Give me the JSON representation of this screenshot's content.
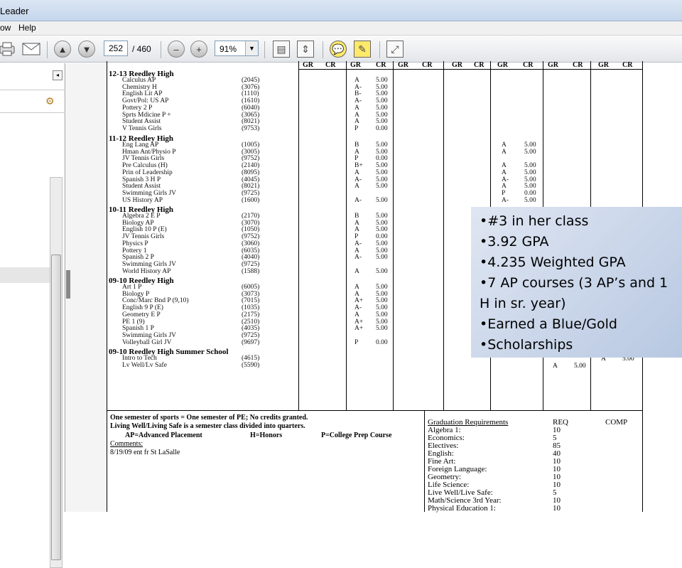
{
  "app": {
    "title": "Leader"
  },
  "menu": [
    "ow",
    "Help"
  ],
  "toolbar": {
    "page_current": "252",
    "page_total": "/ 460",
    "zoom": "91%"
  },
  "columns": [
    "GR",
    "CR",
    "GR",
    "CR",
    "GR",
    "CR",
    "GR",
    "CR",
    "GR",
    "CR",
    "GR",
    "CR"
  ],
  "sections": [
    {
      "title": "12-13  Reedley High",
      "courses": [
        {
          "name": "Calculus AP",
          "code": "(2045)",
          "grade": "A",
          "credit": "5.00"
        },
        {
          "name": "Chemistry H",
          "code": "(3076)",
          "grade": "A-",
          "credit": "5.00"
        },
        {
          "name": "English Lit AP",
          "code": "(1110)",
          "grade": "B-",
          "credit": "5.00"
        },
        {
          "name": "Govt/Pol: US AP",
          "code": "(1610)",
          "grade": "A-",
          "credit": "5.00"
        },
        {
          "name": "Pottery 2 P",
          "code": "(6040)",
          "grade": "A",
          "credit": "5.00"
        },
        {
          "name": "Sprts Mdicine P +",
          "code": "(3065)",
          "grade": "A",
          "credit": "5.00"
        },
        {
          "name": "Student Assist",
          "code": "(8021)",
          "grade": "A",
          "credit": "5.00"
        },
        {
          "name": "V Tennis Girls",
          "code": "(9753)",
          "grade": "P",
          "credit": "0.00"
        }
      ]
    },
    {
      "title": "11-12  Reedley High",
      "courses": [
        {
          "name": "Eng Lang AP",
          "code": "(1005)",
          "grade": "B",
          "credit": "5.00",
          "grade2": "A",
          "credit2": "5.00"
        },
        {
          "name": "Hman Ant/Physio P",
          "code": "(3005)",
          "grade": "A",
          "credit": "5.00",
          "grade2": "A",
          "credit2": "5.00"
        },
        {
          "name": "JV Tennis Girls",
          "code": "(9752)",
          "grade": "P",
          "credit": "0.00",
          "grade2": "",
          "credit2": ""
        },
        {
          "name": "Pre Calculus (H)",
          "code": "(2140)",
          "grade": "B+",
          "credit": "5.00",
          "grade2": "A",
          "credit2": "5.00"
        },
        {
          "name": "Prin of Leadership",
          "code": "(8095)",
          "grade": "A",
          "credit": "5.00",
          "grade2": "A",
          "credit2": "5.00"
        },
        {
          "name": "Spanish 3 H P",
          "code": "(4045)",
          "grade": "A-",
          "credit": "5.00",
          "grade2": "A-",
          "credit2": "5.00"
        },
        {
          "name": "Student Assist",
          "code": "(8021)",
          "grade": "A",
          "credit": "5.00",
          "grade2": "A",
          "credit2": "5.00"
        },
        {
          "name": "Swimming Girls JV",
          "code": "(9725)",
          "grade": "",
          "credit": "",
          "grade2": "P",
          "credit2": "0.00"
        },
        {
          "name": "US History AP",
          "code": "(1600)",
          "grade": "A-",
          "credit": "5.00",
          "grade2": "A-",
          "credit2": "5.00"
        }
      ]
    },
    {
      "title": "10-11  Reedley High",
      "courses": [
        {
          "name": "Algebra 2 E P",
          "code": "(2170)",
          "grade": "B",
          "credit": "5.00"
        },
        {
          "name": "Biology AP",
          "code": "(3070)",
          "grade": "A",
          "credit": "5.00"
        },
        {
          "name": "English 10 P (E)",
          "code": "(1050)",
          "grade": "A",
          "credit": "5.00"
        },
        {
          "name": "JV Tennis Girls",
          "code": "(9752)",
          "grade": "P",
          "credit": "0.00"
        },
        {
          "name": "Physics P",
          "code": "(3060)",
          "grade": "A-",
          "credit": "5.00"
        },
        {
          "name": "Pottery 1",
          "code": "(6035)",
          "grade": "A",
          "credit": "5.00"
        },
        {
          "name": "Spanish 2 P",
          "code": "(4040)",
          "grade": "A-",
          "credit": "5.00"
        },
        {
          "name": "Swimming Girls JV",
          "code": "(9725)",
          "grade": "",
          "credit": ""
        },
        {
          "name": "World History AP",
          "code": "(1588)",
          "grade": "A",
          "credit": "5.00"
        }
      ]
    },
    {
      "title": "09-10  Reedley High",
      "courses": [
        {
          "name": "Art 1 P",
          "code": "(6005)",
          "grade": "A",
          "credit": "5.00"
        },
        {
          "name": "Biology P",
          "code": "(3073)",
          "grade": "A",
          "credit": "5.00"
        },
        {
          "name": "Conc/Marc Bnd P (9,10)",
          "code": "(7015)",
          "grade": "A+",
          "credit": "5.00"
        },
        {
          "name": "English 9 P (E)",
          "code": "(1035)",
          "grade": "A-",
          "credit": "5.00"
        },
        {
          "name": "Geometry E P",
          "code": "(2175)",
          "grade": "A",
          "credit": "5.00"
        },
        {
          "name": "PE 1 (9)",
          "code": "(2510)",
          "grade": "A+",
          "credit": "5.00"
        },
        {
          "name": "Spanish 1 P",
          "code": "(4035)",
          "grade": "A+",
          "credit": "5.00"
        },
        {
          "name": "Swimming Girls JV",
          "code": "(9725)",
          "grade": "",
          "credit": ""
        },
        {
          "name": "Volleyball Girl JV",
          "code": "(9697)",
          "grade": "P",
          "credit": "0.00"
        }
      ]
    },
    {
      "title": "09-10  Reedley High Summer School",
      "courses": [
        {
          "name": "Intro to Tech",
          "code": "(4615)",
          "grade": "",
          "credit": ""
        },
        {
          "name": "Lv Well/Lv Safe",
          "code": "(5590)",
          "grade": "",
          "credit": ""
        }
      ]
    }
  ],
  "extra_cells": {
    "lv_grade": "A",
    "lv_credit": "5.00",
    "intro_grade": "A",
    "intro_credit": "5.00"
  },
  "footer": {
    "line1": "One semester of sports = One semester of PE; No credits granted.",
    "line2": "Living Well/Living Safe is a semester class divided into quarters.",
    "ap": "AP=Advanced Placement",
    "h": "H=Honors",
    "p": "P=College Prep Course",
    "comments_label": "Comments:",
    "comment": "8/19/09 ent fr St LaSalle"
  },
  "grad": {
    "title": "Graduation Requirements",
    "req": "REQ",
    "comp": "COMP",
    "rows": [
      {
        "name": "Algebra 1:",
        "req": "10"
      },
      {
        "name": "Economics:",
        "req": "5"
      },
      {
        "name": "Electives:",
        "req": "85"
      },
      {
        "name": "English:",
        "req": "40"
      },
      {
        "name": "Fine Art:",
        "req": "10"
      },
      {
        "name": "Foreign Language:",
        "req": "10"
      },
      {
        "name": "Geometry:",
        "req": "10"
      },
      {
        "name": "Life Science:",
        "req": "10"
      },
      {
        "name": "Live Well/Live Safe:",
        "req": "5"
      },
      {
        "name": "Math/Science 3rd Year:",
        "req": "10"
      },
      {
        "name": "Physical Education 1:",
        "req": "10"
      }
    ]
  },
  "callout": [
    "•#3 in her class",
    "•3.92 GPA",
    "•4.235 Weighted GPA",
    "•7 AP courses (3 AP’s and 1 H in sr. year)",
    "•Earned a Blue/Gold",
    "•Scholarships"
  ]
}
